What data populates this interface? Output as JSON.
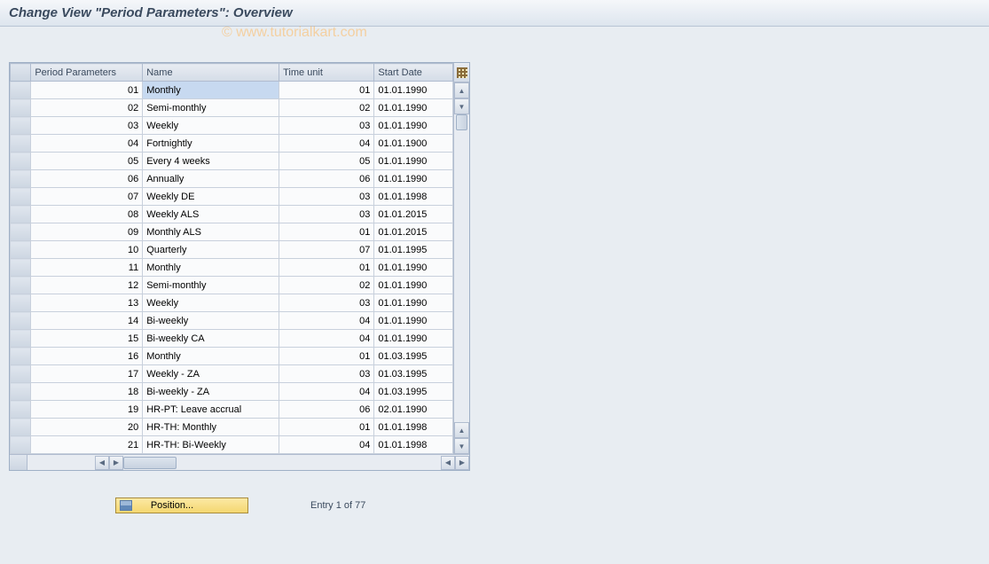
{
  "title": "Change View \"Period Parameters\": Overview",
  "watermark": "© www.tutorialkart.com",
  "columns": {
    "period_parameters": "Period Parameters",
    "name": "Name",
    "time_unit": "Time unit",
    "start_date": "Start Date"
  },
  "rows": [
    {
      "period": "01",
      "name": "Monthly",
      "time_unit": "01",
      "start_date": "01.01.1990",
      "highlighted": true
    },
    {
      "period": "02",
      "name": "Semi-monthly",
      "time_unit": "02",
      "start_date": "01.01.1990"
    },
    {
      "period": "03",
      "name": "Weekly",
      "time_unit": "03",
      "start_date": "01.01.1990"
    },
    {
      "period": "04",
      "name": "Fortnightly",
      "time_unit": "04",
      "start_date": "01.01.1900"
    },
    {
      "period": "05",
      "name": "Every 4 weeks",
      "time_unit": "05",
      "start_date": "01.01.1990"
    },
    {
      "period": "06",
      "name": "Annually",
      "time_unit": "06",
      "start_date": "01.01.1990"
    },
    {
      "period": "07",
      "name": "Weekly  DE",
      "time_unit": "03",
      "start_date": "01.01.1998"
    },
    {
      "period": "08",
      "name": "Weekly ALS",
      "time_unit": "03",
      "start_date": "01.01.2015"
    },
    {
      "period": "09",
      "name": "Monthly ALS",
      "time_unit": "01",
      "start_date": "01.01.2015"
    },
    {
      "period": "10",
      "name": "Quarterly",
      "time_unit": "07",
      "start_date": "01.01.1995"
    },
    {
      "period": "11",
      "name": "Monthly",
      "time_unit": "01",
      "start_date": "01.01.1990"
    },
    {
      "period": "12",
      "name": "Semi-monthly",
      "time_unit": "02",
      "start_date": "01.01.1990"
    },
    {
      "period": "13",
      "name": "Weekly",
      "time_unit": "03",
      "start_date": "01.01.1990"
    },
    {
      "period": "14",
      "name": "Bi-weekly",
      "time_unit": "04",
      "start_date": "01.01.1990"
    },
    {
      "period": "15",
      "name": "Bi-weekly CA",
      "time_unit": "04",
      "start_date": "01.01.1990"
    },
    {
      "period": "16",
      "name": "Monthly",
      "time_unit": "01",
      "start_date": "01.03.1995"
    },
    {
      "period": "17",
      "name": "Weekly - ZA",
      "time_unit": "03",
      "start_date": "01.03.1995"
    },
    {
      "period": "18",
      "name": "Bi-weekly - ZA",
      "time_unit": "04",
      "start_date": "01.03.1995"
    },
    {
      "period": "19",
      "name": "HR-PT: Leave accrual",
      "time_unit": "06",
      "start_date": "02.01.1990"
    },
    {
      "period": "20",
      "name": "HR-TH: Monthly",
      "time_unit": "01",
      "start_date": "01.01.1998"
    },
    {
      "period": "21",
      "name": "HR-TH: Bi-Weekly",
      "time_unit": "04",
      "start_date": "01.01.1998"
    }
  ],
  "footer": {
    "position_label": "Position...",
    "entry_text": "Entry 1 of 77"
  }
}
